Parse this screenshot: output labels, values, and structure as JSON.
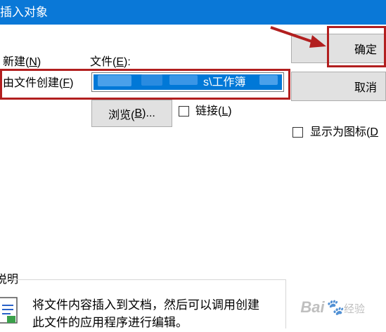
{
  "dialog": {
    "title": "插入对象",
    "create_new": {
      "label": "新建(",
      "key": "N",
      "tail": ")"
    },
    "create_from_file": {
      "label": "由文件创建(",
      "key": "F",
      "tail": ")"
    },
    "file_label": {
      "label": "文件(",
      "key": "E",
      "tail": "):"
    },
    "file_value": "s\\工作簿",
    "browse": {
      "label": "浏览(",
      "key": "B",
      "tail": ")..."
    },
    "link": {
      "label": "链接(",
      "key": "L",
      "tail": ")"
    },
    "ok_label": "确定",
    "cancel_label": "取消",
    "display_as_icon": {
      "label": "显示为图标(",
      "key": "D"
    },
    "result_heading": "说明",
    "result_line1": "将文件内容插入到文档，然后可以调用创建",
    "result_line2": "此文件的应用程序进行编辑。"
  },
  "watermark": {
    "brand": "Bai",
    "paw": "🐾",
    "suffix": "经验"
  },
  "colors": {
    "titlebar": "#0a78d7",
    "selection": "#0078d7",
    "highlight": "#b21f1f",
    "button": "#e1e1e1"
  }
}
